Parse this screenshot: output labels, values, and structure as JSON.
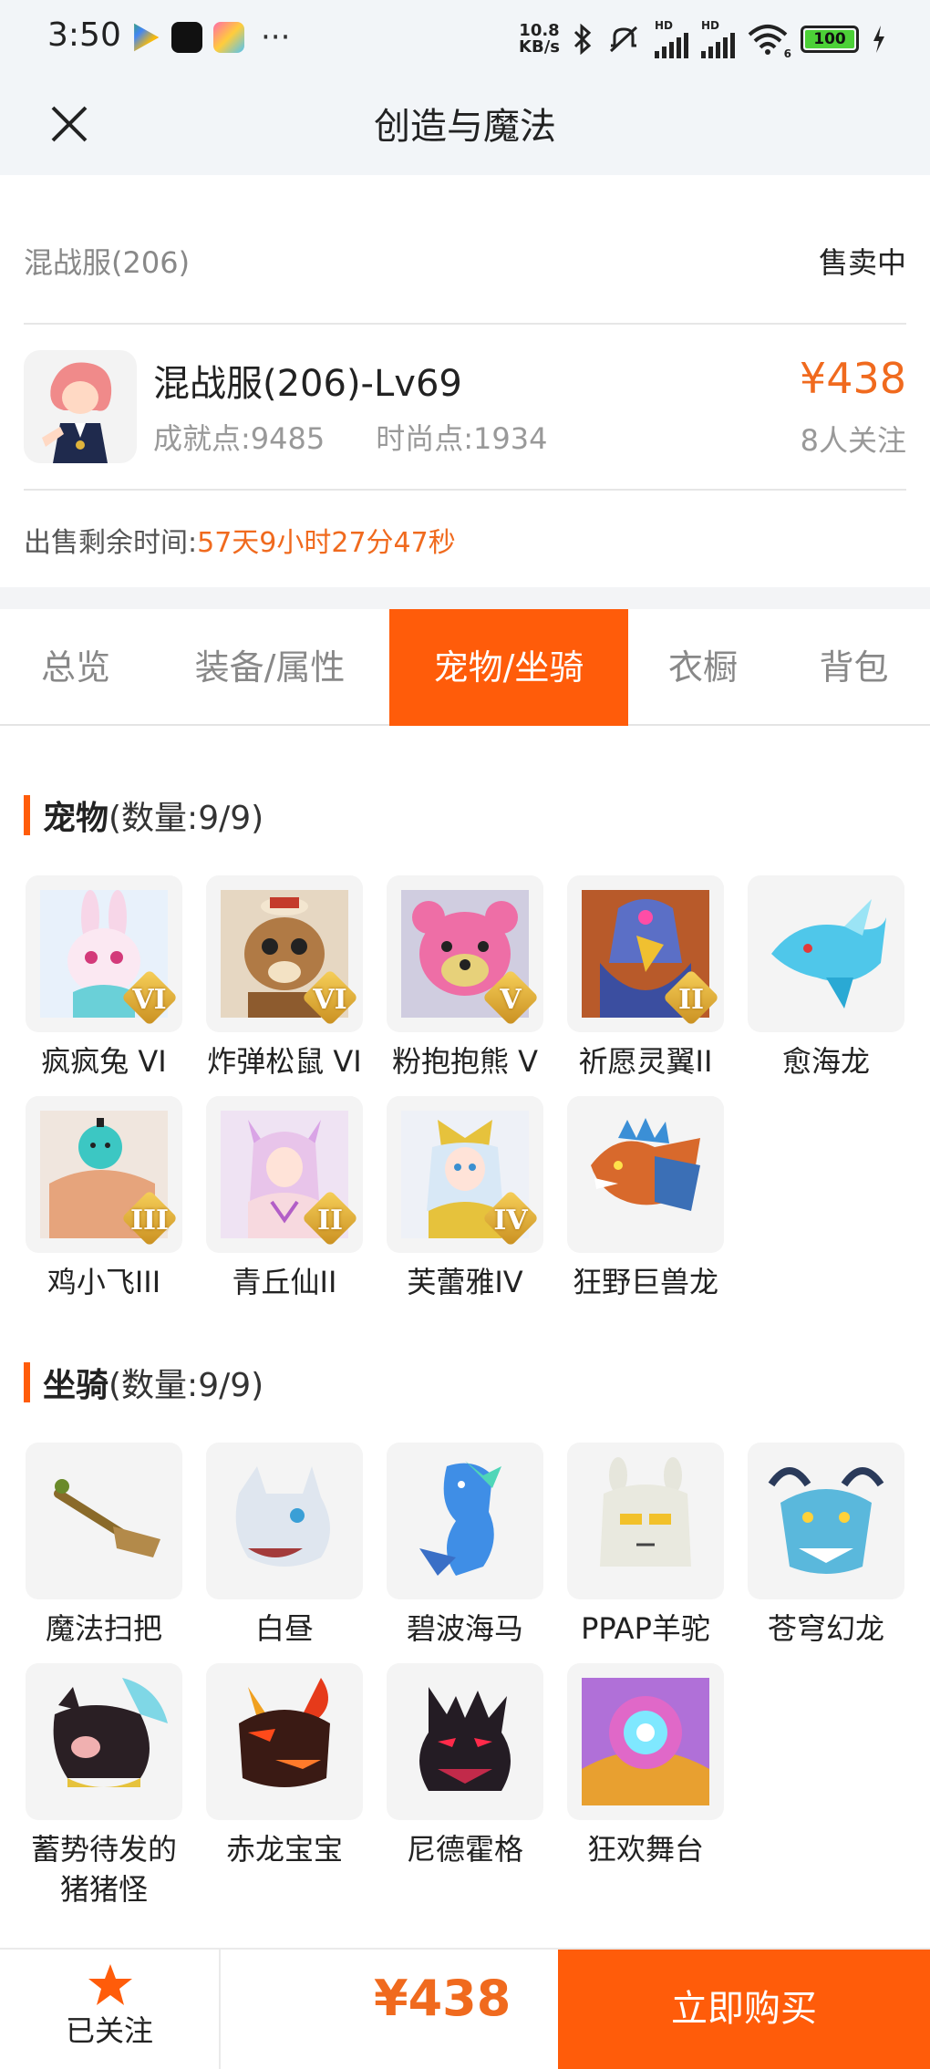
{
  "status_bar": {
    "time": "3:50",
    "net_speed_top": "10.8",
    "net_speed_bottom": "KB/s",
    "battery": "100",
    "hd1": "HD",
    "hd2": "HD",
    "wifi_num": "6"
  },
  "nav": {
    "title": "创造与魔法"
  },
  "listing": {
    "server": "混战服(206)",
    "status": "售卖中",
    "character_name": "混战服(206)-Lv69",
    "achievement": "成就点:9485",
    "fashion": "时尚点:1934",
    "price": "¥438",
    "watchers": "8人关注",
    "remain_label": "出售剩余时间:",
    "remain_value": "57天9小时27分47秒"
  },
  "tabs": [
    {
      "label": "总览"
    },
    {
      "label": "装备/属性"
    },
    {
      "label": "宠物/坐骑"
    },
    {
      "label": "衣橱"
    },
    {
      "label": "背包"
    }
  ],
  "pets": {
    "title": "宠物",
    "count": "(数量:9/9)",
    "items": [
      {
        "name": "疯疯兔 VI",
        "rank": "VI"
      },
      {
        "name": "炸弹松鼠 VI",
        "rank": "VI"
      },
      {
        "name": "粉抱抱熊 V",
        "rank": "V"
      },
      {
        "name": "祈愿灵翼II",
        "rank": "II"
      },
      {
        "name": "愈海龙",
        "rank": ""
      },
      {
        "name": "鸡小飞III",
        "rank": "III"
      },
      {
        "name": "青丘仙II",
        "rank": "II"
      },
      {
        "name": "芙蕾雅IV",
        "rank": "IV"
      },
      {
        "name": "狂野巨兽龙",
        "rank": ""
      }
    ]
  },
  "mounts": {
    "title": "坐骑",
    "count": "(数量:9/9)",
    "items": [
      {
        "name": "魔法扫把"
      },
      {
        "name": "白昼"
      },
      {
        "name": "碧波海马"
      },
      {
        "name": "PPAP羊驼"
      },
      {
        "name": "苍穹幻龙"
      },
      {
        "name": "蓄势待发的",
        "name2": "猪猪怪"
      },
      {
        "name": "赤龙宝宝"
      },
      {
        "name": "尼德霍格"
      },
      {
        "name": "狂欢舞台"
      }
    ]
  },
  "footer": {
    "follow_label": "已关注",
    "price": "¥438",
    "buy_label": "立即购买"
  },
  "colors": {
    "accent": "#ff5c0a",
    "price": "#f06a1e"
  }
}
